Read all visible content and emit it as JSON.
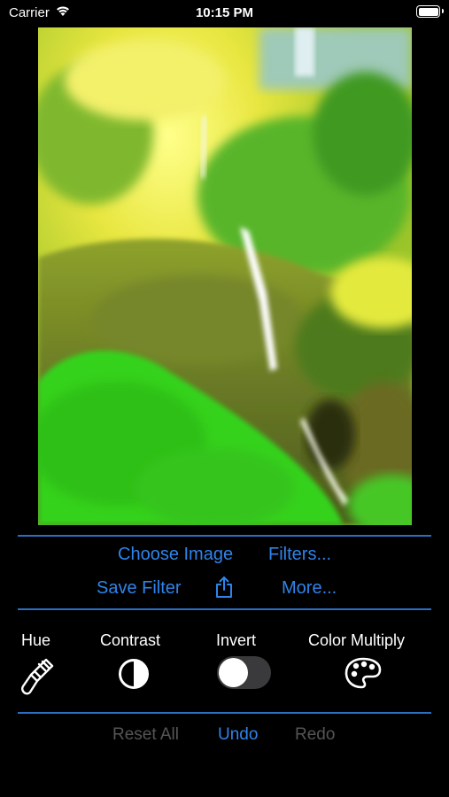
{
  "status_bar": {
    "carrier": "Carrier",
    "time": "10:15 PM",
    "battery_level": 1.0
  },
  "image": {
    "description_icon": "filtered-waterfall-photo"
  },
  "actions": {
    "choose_image": "Choose Image",
    "filters": "Filters...",
    "save_filter": "Save Filter",
    "share_icon": "share-icon",
    "more": "More..."
  },
  "tools": {
    "hue": "Hue",
    "contrast": "Contrast",
    "invert": "Invert",
    "invert_on": false,
    "color_multiply": "Color Multiply"
  },
  "history": {
    "reset_all": "Reset All",
    "undo": "Undo",
    "redo": "Redo"
  },
  "colors": {
    "accent": "#2f84ea",
    "divider": "#2a6fc4",
    "disabled": "#555557"
  }
}
